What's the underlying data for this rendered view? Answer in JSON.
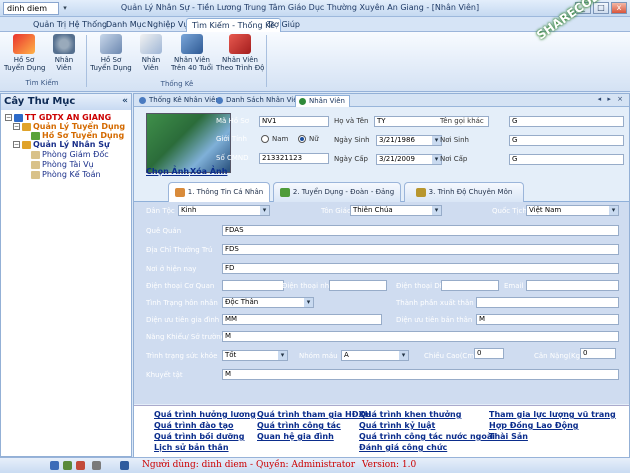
{
  "title_bar": {
    "quick_access_value": "dinh diem",
    "app_title": "Quản Lý Nhân Sự - Tiền Lương Trung Tâm Giáo Dục Thường Xuyên An Giang - [Nhân Viên]",
    "min_label": "_",
    "max_label": "□",
    "close_label": "x"
  },
  "menu_tabs": [
    "Quản Trị Hệ Thống",
    "Danh Mục",
    "Nghiệp Vụ",
    "Tìm Kiếm - Thống Kê",
    "Trợ Giúp"
  ],
  "ribbon": {
    "groups": [
      {
        "label": "Tìm Kiếm",
        "buttons": [
          "Hồ Sơ\nTuyển Dụng",
          "Nhân Viên"
        ]
      },
      {
        "label": "Thống Kê",
        "buttons": [
          "Hồ Sơ\nTuyển Dụng",
          "Nhân Viên",
          "Nhân Viên\nTrên 40 Tuổi",
          "Nhân Viên\nTheo Trình Độ"
        ]
      }
    ]
  },
  "sidebar": {
    "title": "Cây Thư Mục",
    "collapse_icon": "«",
    "tree": [
      {
        "label": "TT GDTX AN GIANG",
        "level": 0,
        "expander": "−",
        "color": "#cc0000"
      },
      {
        "label": "Quản Lý Tuyển Dụng",
        "level": 1,
        "expander": "−",
        "color": "#d46a00"
      },
      {
        "label": "Hồ Sơ Tuyển Dụng",
        "level": 2,
        "expander": "",
        "color": "#d46a00"
      },
      {
        "label": "Quản Lý Nhân Sự",
        "level": 1,
        "expander": "−",
        "color": "#1a2f8a"
      },
      {
        "label": "Phòng Giám Đốc",
        "level": 2,
        "expander": "",
        "color": "#1a2f8a"
      },
      {
        "label": "Phòng Tài Vụ",
        "level": 2,
        "expander": "",
        "color": "#1a2f8a"
      },
      {
        "label": "Phòng Kế Toán",
        "level": 2,
        "expander": "",
        "color": "#1a2f8a"
      }
    ]
  },
  "doc_tabs": [
    "Thống Kê Nhân Viên",
    "Danh Sách Nhân Viên",
    "Nhân Viên"
  ],
  "doc_controls": "◂ ▸ ×",
  "employee": {
    "photo_links": {
      "choose": "Chọn Ảnh",
      "delete": "Xóa Ảnh"
    },
    "labels": {
      "ma_ho_so": "Mã Hồ Sơ",
      "ho_va_ten": "Họ và Tên",
      "ten_goi_khac": "Tên gọi khác",
      "gioi_tinh": "Giới Tính",
      "nam": "Nam",
      "nu": "Nữ",
      "ngay_sinh": "Ngày Sinh",
      "noi_sinh": "Nơi Sinh",
      "so_cmnd": "Số CMND",
      "ngay_cap": "Ngày Cấp",
      "noi_cap": "Nơi Cấp"
    },
    "values": {
      "ma_ho_so": "NV1",
      "ho_va_ten": "TY",
      "ten_goi_khac": "G",
      "gioi_tinh": "Nữ",
      "ngay_sinh": "3/21/1986",
      "noi_sinh": "G",
      "so_cmnd": "213321123",
      "ngay_cap": "3/21/2009",
      "noi_cap": "G"
    }
  },
  "form_tabs": [
    "1. Thông Tin Cá Nhân",
    "2. Tuyển Dụng - Đoàn - Đảng",
    "3. Trình Độ Chuyên Môn"
  ],
  "personal": {
    "labels": {
      "dan_toc": "Dân Tộc",
      "ton_giao": "Tôn Giáo",
      "quoc_tich": "Quốc Tịch",
      "que_quan": "Quê Quán",
      "dia_chi": "Địa Chỉ Thường Trú",
      "noi_o": "Nơi ở hiện nay",
      "dt_co_quan": "Điện thoại Cơ Quan",
      "dt_nha": "Điện thoại nhà",
      "dt_dd": "Điện thoại DĐ",
      "email": "Email",
      "hon_nhan": "Tình Trạng hôn nhân",
      "thanh_phan": "Thành phần xuất thân",
      "uu_tien_gia_dinh": "Diện ưu tiên gia đình",
      "uu_tien_ban_than": "Diện ưu tiên bản thân",
      "nang_khieu": "Năng Khiếu/ Sở trường",
      "suc_khoe": "Trình trạng sức khỏe",
      "nhom_mau": "Nhóm máu",
      "chieu_cao": "Chiều Cao(Cm)",
      "can_nang": "Cân Nặng(Kg)",
      "khuyet_tat": "Khuyết tật"
    },
    "values": {
      "dan_toc": "Kinh",
      "ton_giao": "Thiên Chúa",
      "quoc_tich": "Việt Nam",
      "que_quan": "FDAS",
      "dia_chi": "FDS",
      "noi_o": "FD",
      "dt_co_quan": "",
      "dt_nha": "",
      "dt_dd": "",
      "email": "",
      "hon_nhan": "Độc Thân",
      "thanh_phan": "",
      "uu_tien_gia_dinh": "MM",
      "uu_tien_ban_than": "M",
      "nang_khieu": "M",
      "suc_khoe": "Tốt",
      "nhom_mau": "A",
      "chieu_cao": "0",
      "can_nang": "0",
      "khuyet_tat": "M"
    }
  },
  "bottom_links": [
    [
      "Quá trình hưởng lương",
      "Quá trình tham gia HĐXH",
      "Quá trình khen thưởng",
      "Tham gia lực lượng vũ trang"
    ],
    [
      "Quá trình đào tạo",
      "Quá trình công tác",
      "Quá trình kỷ luật",
      "Hợp Đồng Lao Động"
    ],
    [
      "Quá trình bồi dưỡng",
      "Quan hệ gia đình",
      "Quá trình công tác nước ngoài",
      "Thài Sản"
    ],
    [
      "Lịch sử bản thân",
      "",
      "Đánh giá công chức",
      ""
    ]
  ],
  "status": {
    "text": "Người dùng: dinh diem - Quyền: Administrator",
    "version": "Version: 1.0"
  },
  "watermark": "SHARECODE.vn"
}
